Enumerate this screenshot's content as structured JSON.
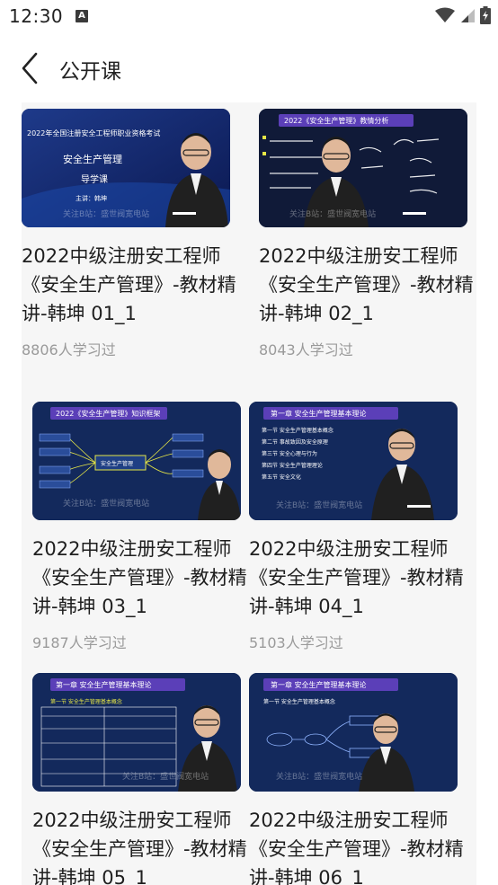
{
  "status_bar": {
    "time": "12:30",
    "app_icon_glyph": "A"
  },
  "header": {
    "title": "公开课",
    "back_icon": "chevron-left-icon"
  },
  "courses": [
    {
      "title": "2022中级注册安工程师《安全生产管理》-教材精讲-韩坤 01_1",
      "learners": "8806人学习过",
      "thumb": {
        "heading": "2022年全国注册安全工程师职业资格考试",
        "line1": "安全生产管理",
        "line2": "导学课",
        "line3": "主讲：韩坤",
        "watermark": "关注B站：盛世阀宽电站"
      }
    },
    {
      "title": "2022中级注册安工程师《安全生产管理》-教材精讲-韩坤 02_1",
      "learners": "8043人学习过",
      "thumb": {
        "heading": "2022《安全生产管理》教情分析",
        "watermark": "关注B站：盛世阀宽电站"
      }
    },
    {
      "title": "2022中级注册安工程师《安全生产管理》-教材精讲-韩坤 03_1",
      "learners": "9187人学习过",
      "thumb": {
        "heading": "2022《安全生产管理》知识框架",
        "center": "安全生产管理",
        "watermark": "关注B站：盛世阀宽电站"
      }
    },
    {
      "title": "2022中级注册安工程师《安全生产管理》-教材精讲-韩坤 04_1",
      "learners": "5103人学习过",
      "thumb": {
        "heading": "第一章 安全生产管理基本理论",
        "items": [
          "第一节 安全生产管理基本概念",
          "第二节 事故致因及安全原理",
          "第三节 安全心理与行为",
          "第四节 安全生产管理理论",
          "第五节 安全文化"
        ],
        "watermark": "关注B站：盛世阀宽电站"
      }
    },
    {
      "title": "2022中级注册安工程师《安全生产管理》-教材精讲-韩坤 05_1",
      "learners": "",
      "thumb": {
        "heading": "第一章 安全生产管理基本理论",
        "sub": "第一节 安全生产管理基本概念",
        "watermark": "关注B站：盛世阀宽电站"
      }
    },
    {
      "title": "2022中级注册安工程师《安全生产管理》-教材精讲-韩坤 06_1",
      "learners": "",
      "thumb": {
        "heading": "第一章 安全生产管理基本理论",
        "sub": "第一节 安全生产管理基本概念",
        "watermark": "关注B站：盛世阀宽电站"
      }
    }
  ],
  "colors": {
    "slide_bg": "#14285e",
    "slide_header": "#5b3fb8",
    "text": "#1f1f1f",
    "meta": "#9a9a9a"
  }
}
